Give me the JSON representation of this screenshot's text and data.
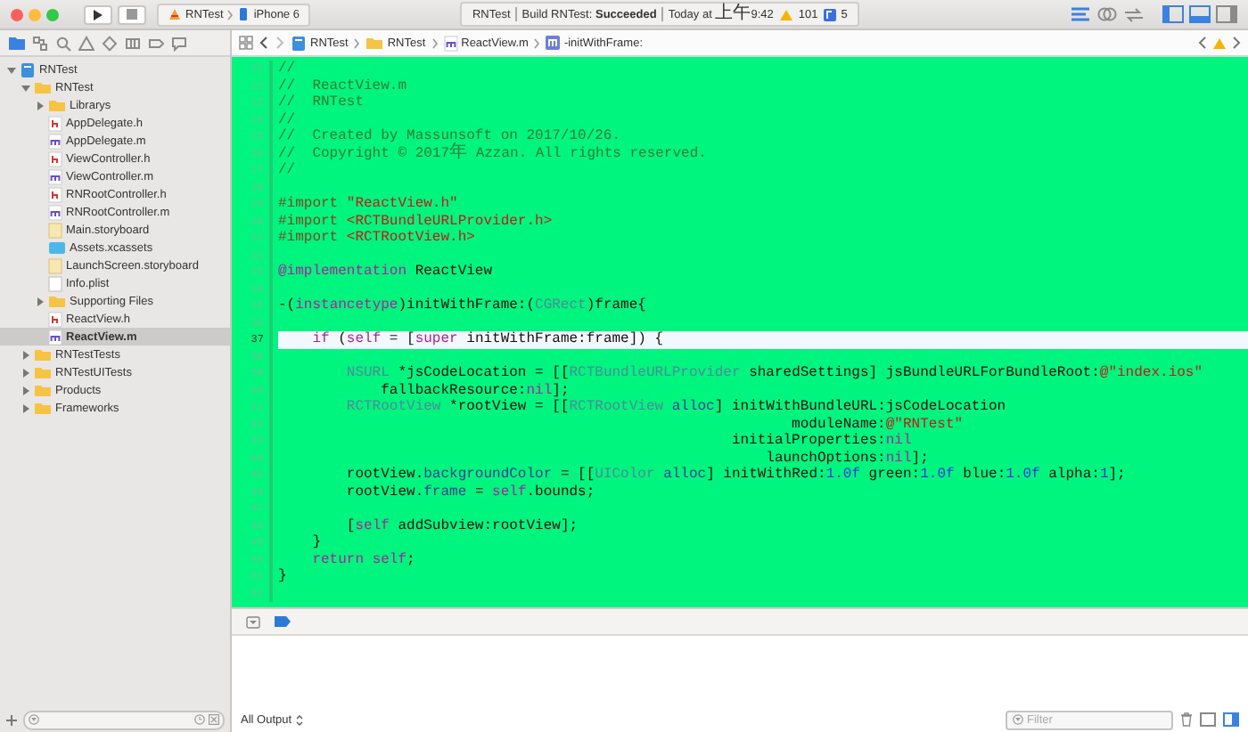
{
  "toolbar": {
    "scheme": "RNTest",
    "device": "iPhone 6",
    "status": {
      "project": "RNTest",
      "build_label": "Build RNTest:",
      "build_result": "Succeeded",
      "time_prefix": "Today at ",
      "time_cjk": "上午",
      "time": "9:42",
      "warnings": "101",
      "issues": "5"
    },
    "editor_modes": [
      {
        "kind": "standard",
        "selected": true
      },
      {
        "kind": "assistant",
        "selected": false
      },
      {
        "kind": "version",
        "selected": false
      }
    ],
    "panels": [
      {
        "kind": "navigator",
        "on": true
      },
      {
        "kind": "debug",
        "on": true
      },
      {
        "kind": "utilities",
        "on": false
      }
    ]
  },
  "navigator": {
    "tabs": [
      {
        "kind": "project",
        "selected": true
      },
      {
        "kind": "symbol",
        "selected": false
      },
      {
        "kind": "search",
        "selected": false
      },
      {
        "kind": "issue",
        "selected": false
      },
      {
        "kind": "test",
        "selected": false
      },
      {
        "kind": "debug",
        "selected": false
      },
      {
        "kind": "breakpoint",
        "selected": false
      },
      {
        "kind": "report",
        "selected": false
      }
    ],
    "tree": [
      {
        "name": "RNTest",
        "kind": "project",
        "expanded": true,
        "selected": false,
        "children": [
          {
            "name": "RNTest",
            "kind": "folder",
            "expanded": true,
            "selected": false,
            "children": [
              {
                "name": "Librarys",
                "kind": "folder",
                "expanded": false,
                "selected": false
              },
              {
                "name": "AppDelegate.h",
                "kind": "h",
                "selected": false
              },
              {
                "name": "AppDelegate.m",
                "kind": "m",
                "selected": false
              },
              {
                "name": "ViewController.h",
                "kind": "h",
                "selected": false
              },
              {
                "name": "ViewController.m",
                "kind": "m",
                "selected": false
              },
              {
                "name": "RNRootController.h",
                "kind": "h",
                "selected": false
              },
              {
                "name": "RNRootController.m",
                "kind": "m",
                "selected": false
              },
              {
                "name": "Main.storyboard",
                "kind": "storyboard",
                "selected": false
              },
              {
                "name": "Assets.xcassets",
                "kind": "assets",
                "selected": false
              },
              {
                "name": "LaunchScreen.storyboard",
                "kind": "storyboard",
                "selected": false
              },
              {
                "name": "Info.plist",
                "kind": "plist",
                "selected": false
              },
              {
                "name": "Supporting Files",
                "kind": "folder",
                "expanded": false,
                "selected": false
              },
              {
                "name": "ReactView.h",
                "kind": "h",
                "selected": false
              },
              {
                "name": "ReactView.m",
                "kind": "m",
                "selected": true
              }
            ]
          },
          {
            "name": "RNTestTests",
            "kind": "folder",
            "expanded": false,
            "selected": false
          },
          {
            "name": "RNTestUITests",
            "kind": "folder",
            "expanded": false,
            "selected": false
          },
          {
            "name": "Products",
            "kind": "folder",
            "expanded": false,
            "selected": false
          },
          {
            "name": "Frameworks",
            "kind": "folder",
            "expanded": false,
            "selected": false
          }
        ]
      }
    ]
  },
  "jump_bar": [
    {
      "label": "RNTest",
      "kind": "project"
    },
    {
      "label": "RNTest",
      "kind": "folder"
    },
    {
      "label": "ReactView.m",
      "kind": "m"
    },
    {
      "label": "-initWithFrame:",
      "kind": "method"
    }
  ],
  "editor": {
    "lines": [
      {
        "number": "21",
        "current": false,
        "tokens": [
          {
            "kind": "comment",
            "text": "//"
          }
        ]
      },
      {
        "number": "22",
        "current": false,
        "tokens": [
          {
            "kind": "comment",
            "text": "//  ReactView.m"
          }
        ]
      },
      {
        "number": "23",
        "current": false,
        "tokens": [
          {
            "kind": "comment",
            "text": "//  RNTest"
          }
        ]
      },
      {
        "number": "24",
        "current": false,
        "tokens": [
          {
            "kind": "comment",
            "text": "//"
          }
        ]
      },
      {
        "number": "25",
        "current": false,
        "tokens": [
          {
            "kind": "comment",
            "text": "//  Created by Massunsoft on 2017/10/26."
          }
        ]
      },
      {
        "number": "26",
        "current": false,
        "tokens": [
          {
            "kind": "comment",
            "text": "//  Copyright © 2017"
          },
          {
            "kind": "comment_cjk",
            "text": "年"
          },
          {
            "kind": "comment",
            "text": " Azzan. All rights reserved."
          }
        ]
      },
      {
        "number": "27",
        "current": false,
        "tokens": [
          {
            "kind": "comment",
            "text": "//"
          }
        ]
      },
      {
        "number": "28",
        "current": false
      },
      {
        "number": "29",
        "current": false,
        "tokens": [
          {
            "kind": "directive",
            "text": "#import "
          },
          {
            "kind": "string",
            "text": "\"ReactView.h\""
          }
        ]
      },
      {
        "number": "30",
        "current": false,
        "tokens": [
          {
            "kind": "directive",
            "text": "#import "
          },
          {
            "kind": "string",
            "text": "<RCTBundleURLProvider.h>"
          }
        ]
      },
      {
        "number": "31",
        "current": false,
        "tokens": [
          {
            "kind": "directive",
            "text": "#import "
          },
          {
            "kind": "string",
            "text": "<RCTRootView.h>"
          }
        ]
      },
      {
        "number": "32",
        "current": false
      },
      {
        "number": "33",
        "current": false,
        "tokens": [
          {
            "kind": "keyword",
            "text": "@implementation"
          },
          {
            "kind": "plain",
            "text": " ReactView"
          }
        ]
      },
      {
        "number": "34",
        "current": false
      },
      {
        "number": "35",
        "current": false,
        "tokens": [
          {
            "kind": "plain",
            "text": "-("
          },
          {
            "kind": "keyword",
            "text": "instancetype"
          },
          {
            "kind": "plain",
            "text": ")initWithFrame:("
          },
          {
            "kind": "type",
            "text": "CGRect"
          },
          {
            "kind": "plain",
            "text": ")frame{"
          }
        ]
      },
      {
        "number": "36",
        "current": false
      },
      {
        "number": "37",
        "current": true,
        "tokens": [
          {
            "kind": "keyword",
            "text": "    if"
          },
          {
            "kind": "plain",
            "text": " ("
          },
          {
            "kind": "keyword",
            "text": "self"
          },
          {
            "kind": "plain",
            "text": " = ["
          },
          {
            "kind": "keyword",
            "text": "super"
          },
          {
            "kind": "plain",
            "text": " initWithFrame:frame]) {"
          }
        ]
      },
      {
        "number": "38",
        "current": false
      },
      {
        "number": "39",
        "current": false,
        "tokens": [
          {
            "kind": "type",
            "text": "        NSURL"
          },
          {
            "kind": "plain",
            "text": " *jsCodeLocation = [["
          },
          {
            "kind": "type",
            "text": "RCTBundleURLProvider"
          },
          {
            "kind": "plain",
            "text": " sharedSettings] jsBundleURLForBundleRoot:"
          },
          {
            "kind": "string",
            "text": "@\"index.ios\""
          }
        ]
      },
      {
        "number": "40",
        "current": false,
        "tokens": [
          {
            "kind": "plain",
            "text": "            fallbackResource:"
          },
          {
            "kind": "keyword",
            "text": "nil"
          },
          {
            "kind": "plain",
            "text": "];"
          }
        ]
      },
      {
        "number": "41",
        "current": false,
        "tokens": [
          {
            "kind": "type",
            "text": "        RCTRootView"
          },
          {
            "kind": "plain",
            "text": " *rootView = [["
          },
          {
            "kind": "type",
            "text": "RCTRootView"
          },
          {
            "kind": "call",
            "text": " alloc"
          },
          {
            "kind": "plain",
            "text": "] initWithBundleURL:jsCodeLocation"
          }
        ]
      },
      {
        "number": "42",
        "current": false,
        "tokens": [
          {
            "kind": "plain",
            "text": "                                                            moduleName:"
          },
          {
            "kind": "string",
            "text": "@\"RNTest\""
          }
        ]
      },
      {
        "number": "43",
        "current": false,
        "tokens": [
          {
            "kind": "plain",
            "text": "                                                     initialProperties:"
          },
          {
            "kind": "keyword",
            "text": "nil"
          }
        ]
      },
      {
        "number": "44",
        "current": false,
        "tokens": [
          {
            "kind": "plain",
            "text": "                                                         launchOptions:"
          },
          {
            "kind": "keyword",
            "text": "nil"
          },
          {
            "kind": "plain",
            "text": "];"
          }
        ]
      },
      {
        "number": "45",
        "current": false,
        "tokens": [
          {
            "kind": "plain",
            "text": "        rootView."
          },
          {
            "kind": "call",
            "text": "backgroundColor"
          },
          {
            "kind": "plain",
            "text": " = [["
          },
          {
            "kind": "type",
            "text": "UIColor"
          },
          {
            "kind": "call",
            "text": " alloc"
          },
          {
            "kind": "plain",
            "text": "] initWithRed:"
          },
          {
            "kind": "number",
            "text": "1.0f"
          },
          {
            "kind": "plain",
            "text": " green:"
          },
          {
            "kind": "number",
            "text": "1.0f"
          },
          {
            "kind": "plain",
            "text": " blue:"
          },
          {
            "kind": "number",
            "text": "1.0f"
          },
          {
            "kind": "plain",
            "text": " alpha:"
          },
          {
            "kind": "number",
            "text": "1"
          },
          {
            "kind": "plain",
            "text": "];"
          }
        ]
      },
      {
        "number": "46",
        "current": false,
        "tokens": [
          {
            "kind": "plain",
            "text": "        rootView."
          },
          {
            "kind": "call",
            "text": "frame"
          },
          {
            "kind": "plain",
            "text": " = "
          },
          {
            "kind": "keyword",
            "text": "self"
          },
          {
            "kind": "plain",
            "text": ".bounds;"
          }
        ]
      },
      {
        "number": "47",
        "current": false
      },
      {
        "number": "48",
        "current": false,
        "tokens": [
          {
            "kind": "plain",
            "text": "        ["
          },
          {
            "kind": "keyword",
            "text": "self"
          },
          {
            "kind": "plain",
            "text": " addSubview:rootView];"
          }
        ]
      },
      {
        "number": "49",
        "current": false,
        "tokens": [
          {
            "kind": "plain",
            "text": "    }"
          }
        ]
      },
      {
        "number": "50",
        "current": false,
        "tokens": [
          {
            "kind": "keyword",
            "text": "    return"
          },
          {
            "kind": "keyword",
            "text": " self"
          },
          {
            "kind": "plain",
            "text": ";"
          }
        ]
      },
      {
        "number": "51",
        "current": false,
        "tokens": [
          {
            "kind": "plain",
            "text": "}"
          }
        ]
      },
      {
        "number": "52",
        "current": false
      }
    ]
  },
  "debug": {
    "output_selector": "All Output",
    "filter": {
      "placeholder": "Filter"
    },
    "views": [
      {
        "kind": "variables",
        "on": false
      },
      {
        "kind": "console",
        "on": true
      }
    ]
  }
}
